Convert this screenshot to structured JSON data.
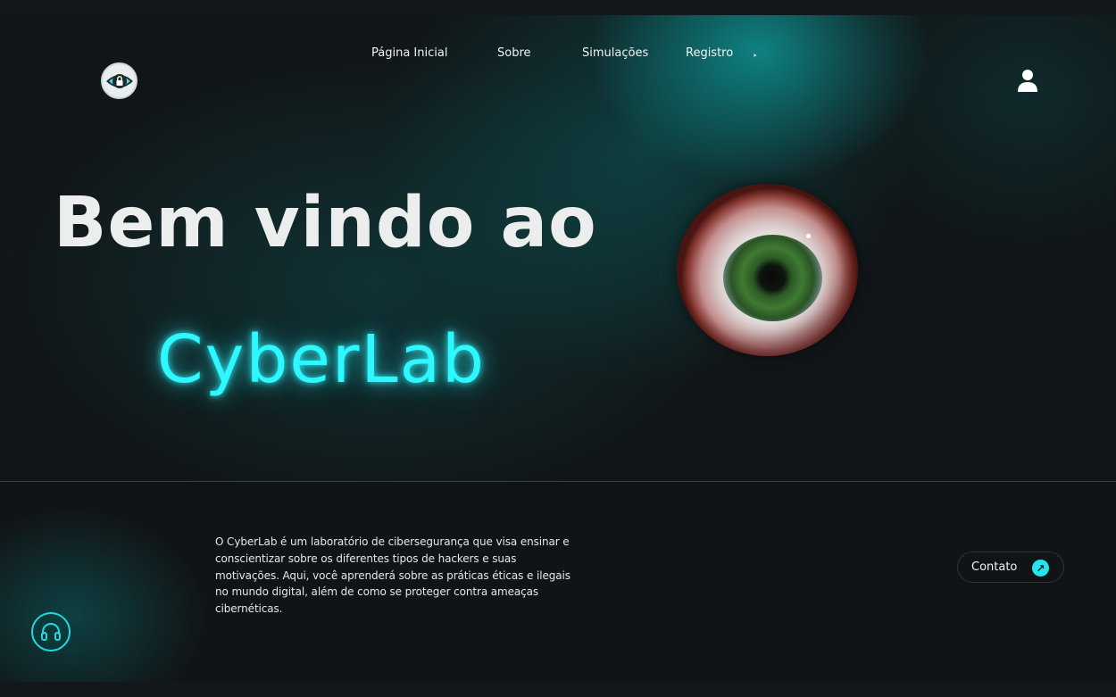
{
  "nav": {
    "items": [
      {
        "label": "Página Inicial"
      },
      {
        "label": "Sobre"
      },
      {
        "label": "Simulações"
      },
      {
        "label": "Registro"
      }
    ]
  },
  "hero": {
    "title_line1": "Bem vindo ao",
    "title_line2": "CyberLab"
  },
  "about": {
    "text": "O CyberLab é um laboratório de cibersegurança que visa ensinar e conscientizar sobre os diferentes tipos de hackers e suas motivações. Aqui, você aprenderá sobre as práticas éticas e ilegais no mundo digital, além de como se proteger contra ameaças cibernéticas."
  },
  "contact": {
    "label": "Contato",
    "arrow": "↗"
  },
  "icons": {
    "logo": "eye-lock-icon",
    "user": "user-icon",
    "support": "headphones-icon",
    "registro_caret": "caret-icon"
  },
  "colors": {
    "accent": "#2ff7ff",
    "background": "#131618",
    "text": "#eceeee"
  }
}
